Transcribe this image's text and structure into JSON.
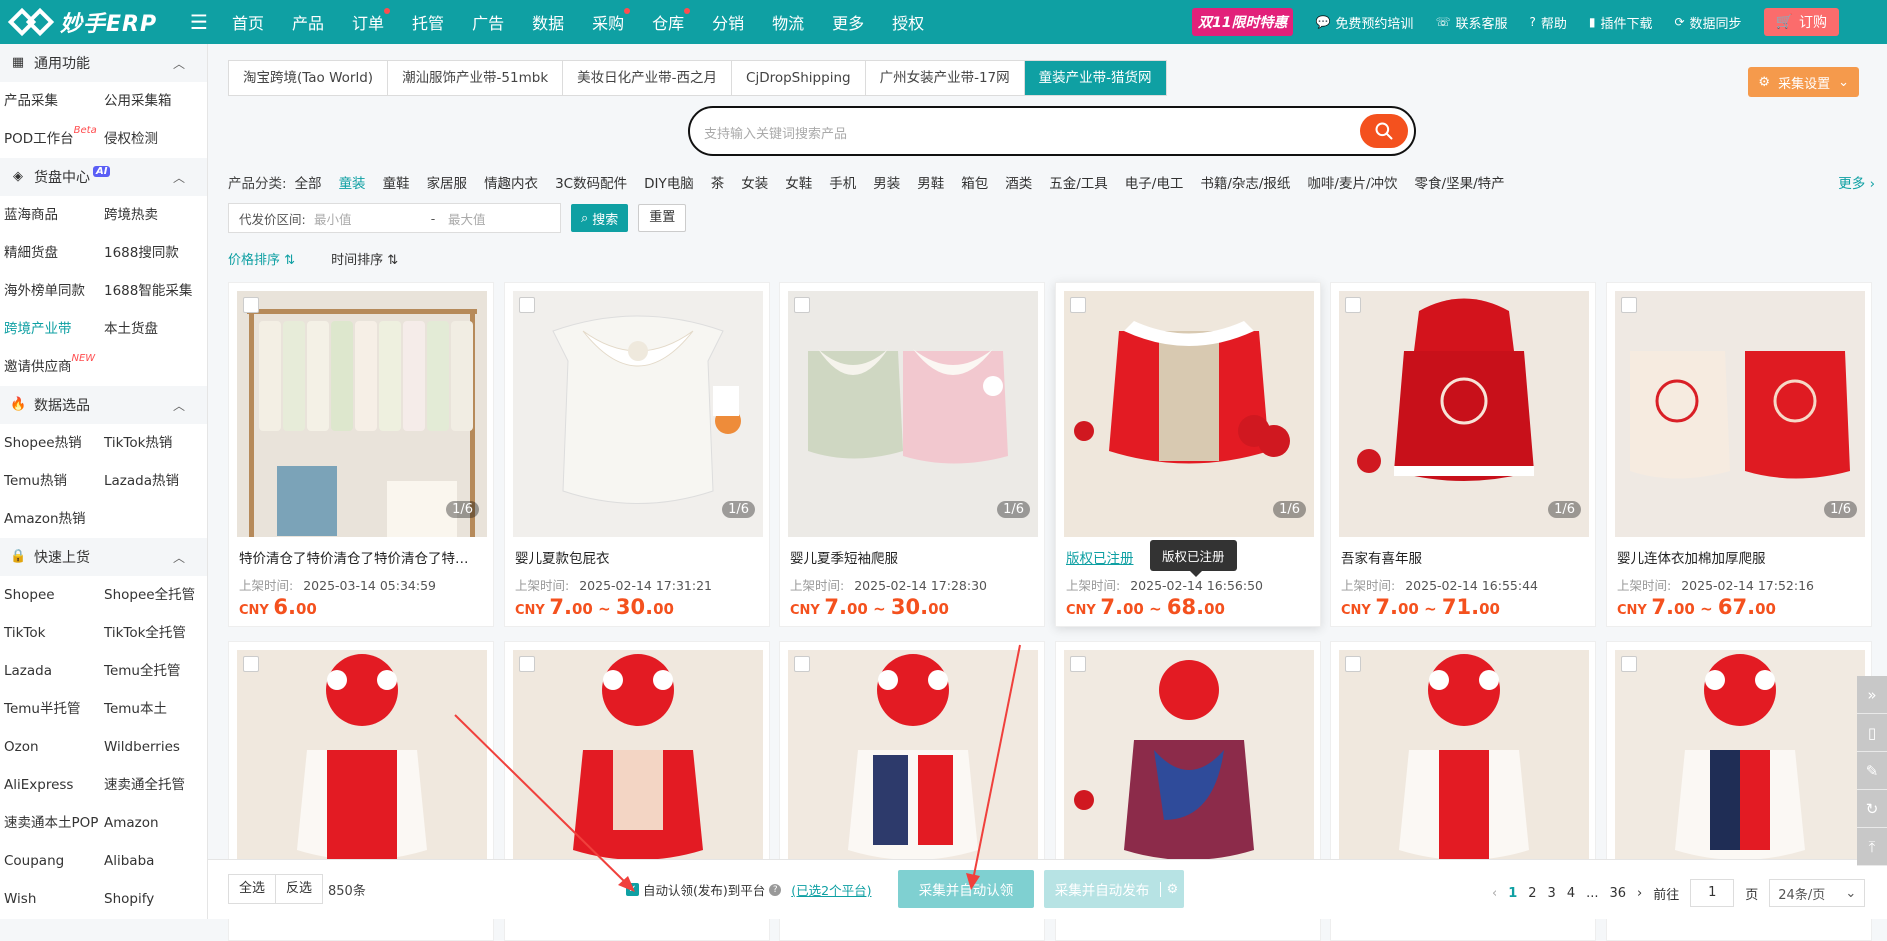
{
  "app": {
    "logo_text": "妙手ERP"
  },
  "topnav": {
    "items": [
      {
        "label": "首页",
        "dot": false
      },
      {
        "label": "产品",
        "dot": false
      },
      {
        "label": "订单",
        "dot": true
      },
      {
        "label": "托管",
        "dot": false
      },
      {
        "label": "广告",
        "dot": false
      },
      {
        "label": "数据",
        "dot": false
      },
      {
        "label": "采购",
        "dot": true
      },
      {
        "label": "仓库",
        "dot": true
      },
      {
        "label": "分销",
        "dot": false
      },
      {
        "label": "物流",
        "dot": false
      },
      {
        "label": "更多",
        "dot": false
      },
      {
        "label": "授权",
        "dot": false
      }
    ],
    "promo": "双11限时特惠",
    "training": "免费预约培训",
    "service": "联系客服",
    "help": "帮助",
    "plugin": "插件下载",
    "sync": "数据同步",
    "order": "订购"
  },
  "sidebar": {
    "sections": [
      {
        "title": "通用功能",
        "icon": "grid-icon",
        "links": [
          "产品采集",
          "公用采集箱",
          "POD工作台",
          "侵权检测"
        ],
        "badges": {
          "POD工作台": "Beta"
        }
      },
      {
        "title": "货盘中心",
        "icon": "cube-icon",
        "ai": "AI",
        "links": [
          "蓝海商品",
          "跨境热卖",
          "精細货盘",
          "1688搜同款",
          "海外榜单同款",
          "1688智能采集",
          "跨境产业带",
          "本土货盘",
          "邀请供应商"
        ],
        "active": "跨境产业带",
        "badges": {
          "邀请供应商": "NEW"
        }
      },
      {
        "title": "数据选品",
        "icon": "flame-icon",
        "links": [
          "Shopee热销",
          "TikTok热销",
          "Temu热销",
          "Lazada热销",
          "Amazon热销"
        ]
      },
      {
        "title": "快速上货",
        "icon": "bag-icon",
        "links": [
          "Shopee",
          "Shopee全托管",
          "TikTok",
          "TikTok全托管",
          "Lazada",
          "Temu全托管",
          "Temu半托管",
          "Temu本土",
          "Ozon",
          "Wildberries",
          "AliExpress",
          "速卖通全托管",
          "速卖通本土POP",
          "Amazon",
          "Coupang",
          "Alibaba",
          "Wish",
          "Shopify"
        ]
      }
    ]
  },
  "tabs": [
    "淘宝跨境(Tao World)",
    "潮汕服饰产业带-51mbk",
    "美妆日化产业带-西之月",
    "CjDropShipping",
    "广州女装产业带-17网",
    "童装产业带-猎货网"
  ],
  "active_tab": "童装产业带-猎货网",
  "collect_settings": "采集设置",
  "search": {
    "placeholder": "支持输入关键词搜索产品"
  },
  "categories": {
    "label": "产品分类:",
    "items": [
      "全部",
      "童装",
      "童鞋",
      "家居服",
      "情趣内衣",
      "3C数码配件",
      "DIY电脑",
      "茶",
      "女装",
      "女鞋",
      "手机",
      "男装",
      "男鞋",
      "箱包",
      "酒类",
      "五金/工具",
      "电子/电工",
      "书籍/杂志/报纸",
      "咖啡/麦片/冲饮",
      "零食/坚果/特产"
    ],
    "active": "童装",
    "more": "更多"
  },
  "filter": {
    "label": "代发价区间:",
    "min_placeholder": "最小值",
    "dash": "-",
    "max_placeholder": "最大值",
    "search": "搜索",
    "reset": "重置"
  },
  "sort": {
    "price": "价格排序",
    "time": "时间排序"
  },
  "products": [
    {
      "title": "特价清仓了特价清仓了特价清仓了特价...",
      "time_label": "上架时间:",
      "time": "2025-03-14 05:34:59",
      "cur": "CNY",
      "min": "6.",
      "min_dec": "00",
      "max": "",
      "max_dec": "",
      "count": "1/6"
    },
    {
      "title": "婴儿夏款包屁衣",
      "time_label": "上架时间:",
      "time": "2025-02-14 17:31:21",
      "cur": "CNY",
      "min": "7.",
      "min_dec": "00",
      "max": "30.",
      "max_dec": "00",
      "count": "1/6"
    },
    {
      "title": "婴儿夏季短袖爬服",
      "time_label": "上架时间:",
      "time": "2025-02-14 17:28:30",
      "cur": "CNY",
      "min": "7.",
      "min_dec": "00",
      "max": "30.",
      "max_dec": "00",
      "count": "1/6"
    },
    {
      "title": "版权已注册",
      "time_label": "上架时间:",
      "time": "2025-02-14 16:56:50",
      "cur": "CNY",
      "min": "7.",
      "min_dec": "00",
      "max": "68.",
      "max_dec": "00",
      "count": "1/6",
      "link": true
    },
    {
      "title": "吾家有喜年服",
      "time_label": "上架时间:",
      "time": "2025-02-14 16:55:44",
      "cur": "CNY",
      "min": "7.",
      "min_dec": "00",
      "max": "71.",
      "max_dec": "00",
      "count": "1/6"
    },
    {
      "title": "婴儿连体衣加棉加厚爬服",
      "time_label": "上架时间:",
      "time": "2025-02-14 17:52:16",
      "cur": "CNY",
      "min": "7.",
      "min_dec": "00",
      "max": "67.",
      "max_dec": "00",
      "count": "1/6"
    }
  ],
  "tooltip": "版权已注册",
  "bottom": {
    "select_all": "全选",
    "invert": "反选",
    "count": "850条",
    "auto_label": "自动认领(发布)到平台",
    "auto_link": "(已选2个平台)",
    "btn_collect": "采集并自动认领",
    "btn_publish": "采集并自动发布",
    "pages": [
      "1",
      "2",
      "3",
      "4",
      "...",
      "36"
    ],
    "goto": "前往",
    "page_input": "1",
    "page_unit": "页",
    "page_size": "24条/页"
  },
  "colors": {
    "primary": "#0fa0a3",
    "price": "#f4511e",
    "promo": "#e2217a"
  }
}
